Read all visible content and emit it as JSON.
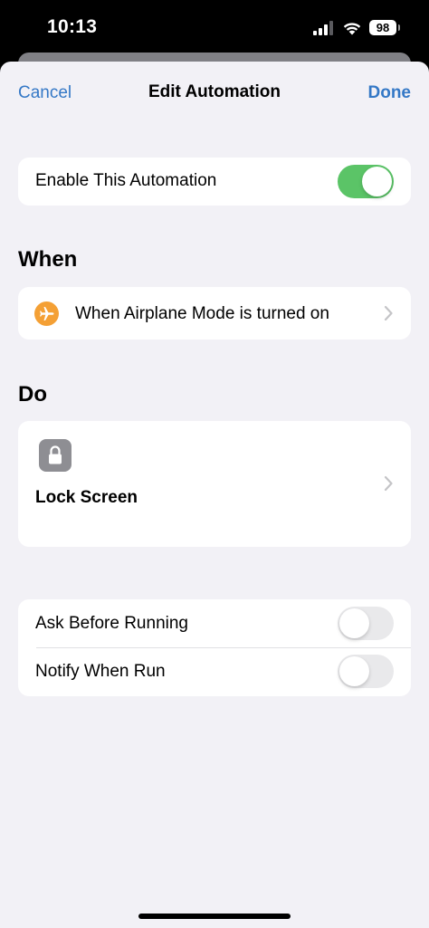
{
  "status_bar": {
    "time": "10:13",
    "battery": "98"
  },
  "nav": {
    "cancel_label": "Cancel",
    "title": "Edit Automation",
    "done_label": "Done"
  },
  "enable": {
    "label": "Enable This Automation",
    "on": true
  },
  "when": {
    "header": "When",
    "trigger_label": "When Airplane Mode is turned on",
    "icon": "airplane-icon",
    "icon_color": "#f4a035"
  },
  "do": {
    "header": "Do",
    "action_label": "Lock Screen",
    "icon": "lock-icon",
    "icon_color": "#8e8e93"
  },
  "options": {
    "ask_before_running": {
      "label": "Ask Before Running",
      "on": false
    },
    "notify_when_run": {
      "label": "Notify When Run",
      "on": false
    }
  },
  "colors": {
    "accent": "#3478c6",
    "toggle_on": "#5bc467",
    "toggle_off": "#e9e9eb",
    "background": "#f2f1f6"
  }
}
